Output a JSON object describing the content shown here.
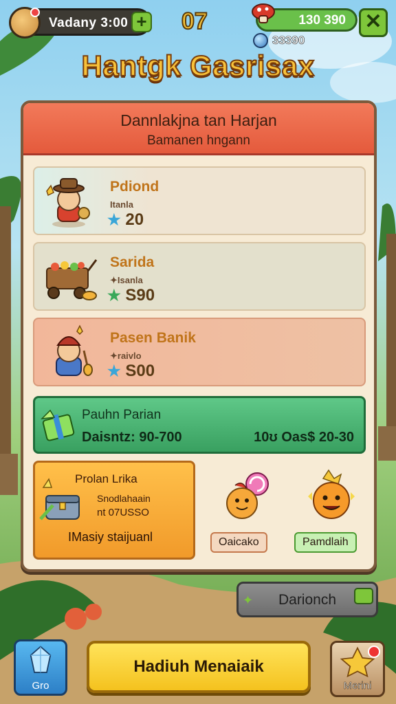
{
  "header": {
    "coin_label": "Vadany 3:00",
    "plus_label": "+",
    "timer": "07",
    "gem_label": "130 390",
    "gem_sub_label": "33390",
    "close_label": "✕"
  },
  "title": "Hantgk Gasrisax",
  "panel": {
    "header_line1": "Dannlakjna tan Harjan",
    "header_line2": "Bamanen hngann",
    "rows": [
      {
        "name": "Pdiond",
        "sub": "Itanla",
        "star": "★",
        "price": "20"
      },
      {
        "name": "Sarida",
        "sub": "✦Isanla",
        "star": "★",
        "price": "S90"
      },
      {
        "name": "Pasen Banik",
        "sub": "✦raivlo",
        "star": "★",
        "price": "S00"
      }
    ],
    "green_bar": {
      "name": "Pauhn Parian",
      "left_value": "Daisntz: 90-700",
      "right_value": "10ʊ Oas$ 20-30"
    },
    "offer": {
      "title": "Prolan Lrika",
      "sub": "Snodlahaain",
      "price": "nt 07USSO",
      "action": "IMasiy staijuanl"
    },
    "items": [
      {
        "label": "Oaicako"
      },
      {
        "label": "Pamdlaih"
      }
    ]
  },
  "side_button": {
    "label": "Darionch",
    "icon": "✦"
  },
  "bottom": {
    "left_label": "Gro",
    "main_label": "Hadiuh Menaiaik",
    "right_label": "Merini"
  },
  "colors": {
    "accent_red": "#e45a3c",
    "accent_green": "#39a060",
    "accent_yellow": "#f4c21e",
    "panel_bg": "#f7ebd5"
  }
}
